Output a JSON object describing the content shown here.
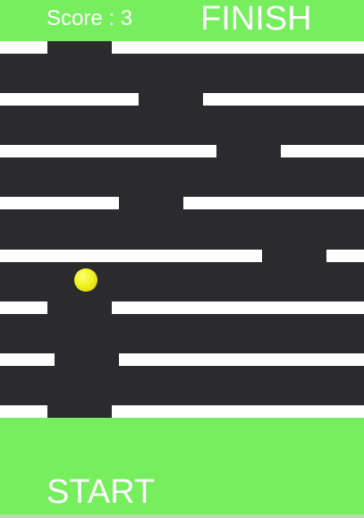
{
  "hud": {
    "score_text": "Score : 3",
    "finish_label": "FINISH",
    "start_label": "START"
  },
  "colors": {
    "zone_green": "#76ee5e",
    "maze_background": "#2b2b2e",
    "wall": "#ffffff",
    "ball": "#f2f21e"
  }
}
